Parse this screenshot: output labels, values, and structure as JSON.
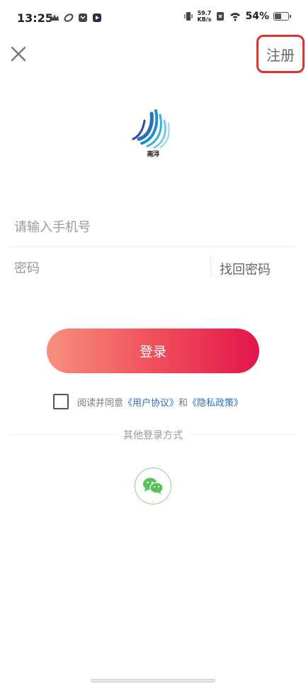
{
  "status_bar": {
    "time": "13:25",
    "net_speed_value": "59.7",
    "net_speed_unit": "KB/s",
    "battery_percent_text": "54%",
    "battery_level": 0.54
  },
  "header": {
    "register_label": "注册"
  },
  "logo": {
    "caption": "南浔"
  },
  "form": {
    "phone_placeholder": "请输入手机号",
    "password_placeholder": "密码",
    "forgot_label": "找回密码",
    "login_label": "登录"
  },
  "agreement": {
    "prefix": "阅读并同意",
    "user_agreement": "《用户协议》",
    "conjunction": "和",
    "privacy_policy": "《隐私政策》"
  },
  "other_login": {
    "label": "其他登录方式",
    "wechat_icon": "wechat-icon"
  },
  "colors": {
    "accent_start": "#f7907e",
    "accent_end": "#e4154b",
    "link": "#2a6fc9",
    "register_highlight": "#e03030"
  }
}
